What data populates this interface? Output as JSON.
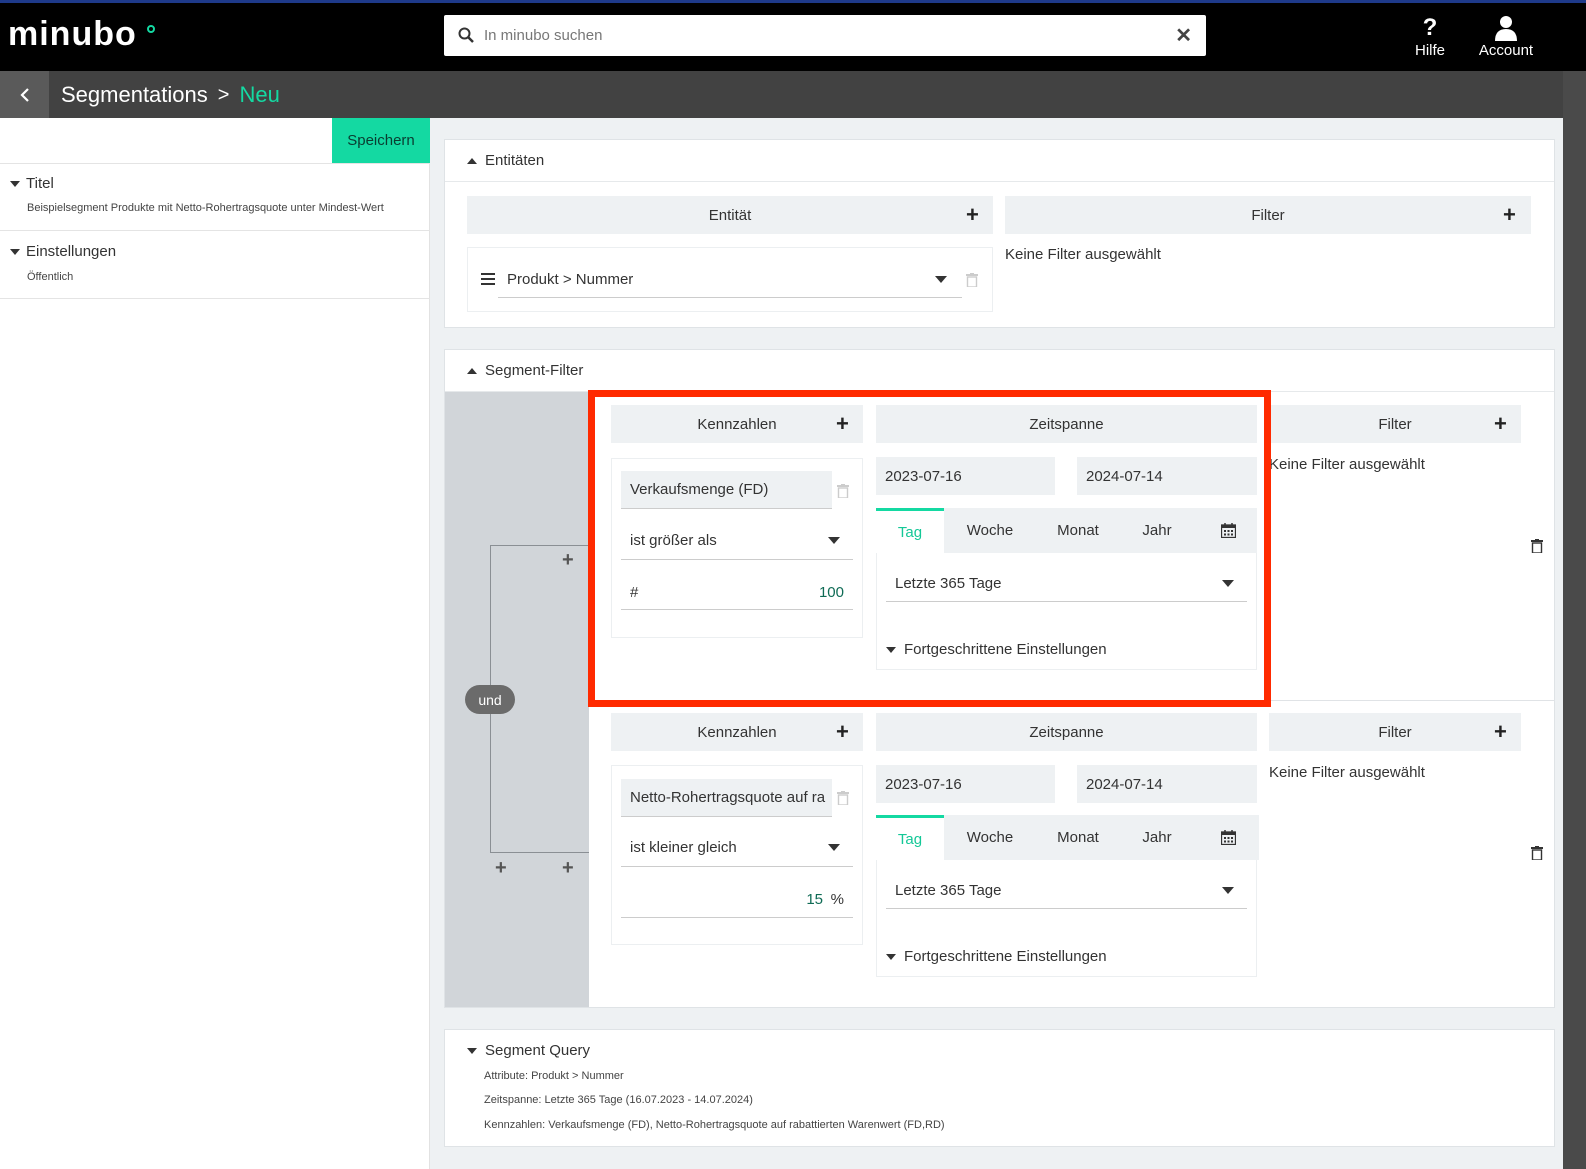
{
  "topbar": {
    "logo_text": "minubo",
    "search_placeholder": "In minubo suchen",
    "help_label": "Hilfe",
    "account_label": "Account"
  },
  "breadcrumb": {
    "parent": "Segmentations",
    "separator": ">",
    "current": "Neu"
  },
  "sidebar": {
    "save_label": "Speichern",
    "sections": [
      {
        "title": "Titel",
        "value": "Beispielsegment Produkte mit Netto-Rohertragsquote unter Mindest-Wert"
      },
      {
        "title": "Einstellungen",
        "value": "Öffentlich"
      }
    ]
  },
  "entities": {
    "title": "Entitäten",
    "entity_header": "Entität",
    "filter_header": "Filter",
    "entity_value": "Produkt > Nummer",
    "no_filter": "Keine Filter ausgewählt"
  },
  "segment_filter": {
    "title": "Segment-Filter",
    "connector": "und",
    "blocks": [
      {
        "kennzahlen_header": "Kennzahlen",
        "zeitspanne_header": "Zeitspanne",
        "filter_header": "Filter",
        "metric": "Verkaufsmenge (FD)",
        "operator": "ist größer als",
        "value_prefix": "#",
        "value": "100",
        "value_suffix": "",
        "date_from": "2023-07-16",
        "date_to": "2024-07-14",
        "tabs": [
          "Tag",
          "Woche",
          "Monat",
          "Jahr"
        ],
        "active_tab": "Tag",
        "range": "Letzte 365 Tage",
        "advanced": "Fortgeschrittene Einstellungen",
        "no_filter": "Keine Filter ausgewählt"
      },
      {
        "kennzahlen_header": "Kennzahlen",
        "zeitspanne_header": "Zeitspanne",
        "filter_header": "Filter",
        "metric": "Netto-Rohertragsquote auf ra",
        "operator": "ist kleiner gleich",
        "value_prefix": "",
        "value": "15",
        "value_suffix": "%",
        "date_from": "2023-07-16",
        "date_to": "2024-07-14",
        "tabs": [
          "Tag",
          "Woche",
          "Monat",
          "Jahr"
        ],
        "active_tab": "Tag",
        "range": "Letzte 365 Tage",
        "advanced": "Fortgeschrittene Einstellungen",
        "no_filter": "Keine Filter ausgewählt"
      }
    ]
  },
  "segment_query": {
    "title": "Segment Query",
    "lines": [
      "Attribute:  Produkt > Nummer",
      "Zeitspanne:  Letzte 365 Tage (16.07.2023 - 14.07.2024)",
      "Kennzahlen:  Verkaufsmenge (FD), Netto-Rohertragsquote auf rabattierten Warenwert (FD,RD)"
    ]
  },
  "colors": {
    "accent": "#14d9a2",
    "highlight": "#ff2a00",
    "topbar": "#000000",
    "crumbbar": "#424242"
  }
}
